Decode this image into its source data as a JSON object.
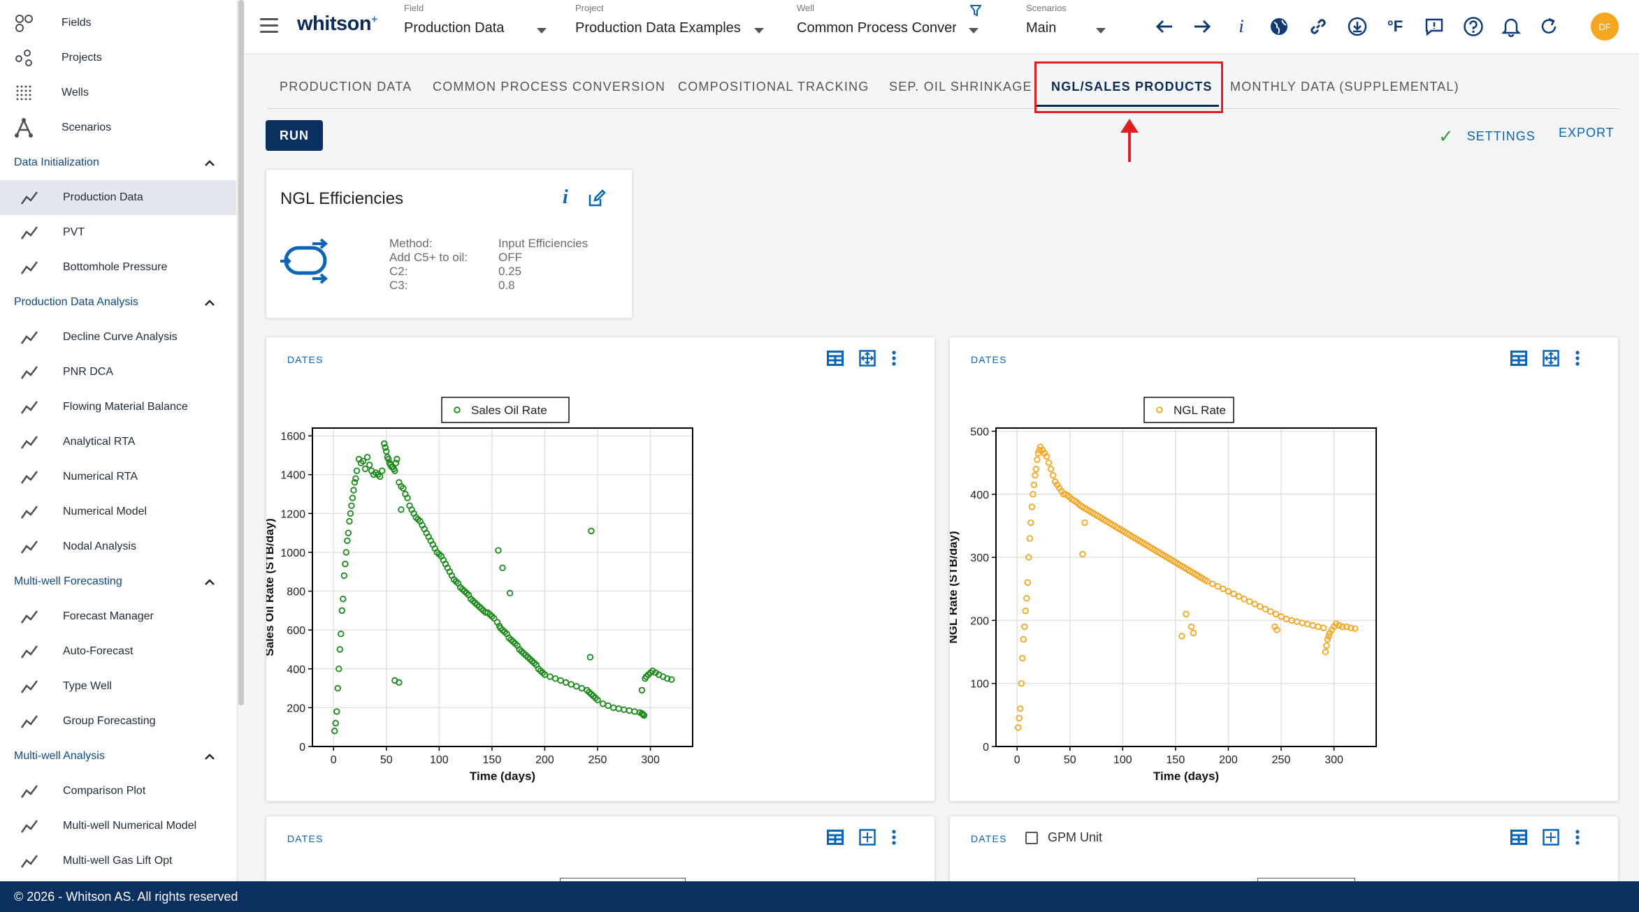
{
  "sidebar": {
    "top_items": [
      {
        "label": "Fields",
        "icon": "fields-icon"
      },
      {
        "label": "Projects",
        "icon": "projects-icon"
      },
      {
        "label": "Wells",
        "icon": "wells-icon"
      },
      {
        "label": "Scenarios",
        "icon": "scenarios-icon"
      }
    ],
    "sections": [
      {
        "label": "Data Initialization",
        "items": [
          "Production Data",
          "PVT",
          "Bottomhole Pressure"
        ]
      },
      {
        "label": "Production Data Analysis",
        "items": [
          "Decline Curve Analysis",
          "PNR DCA",
          "Flowing Material Balance",
          "Analytical RTA",
          "Numerical RTA",
          "Numerical Model",
          "Nodal Analysis"
        ]
      },
      {
        "label": "Multi-well Forecasting",
        "items": [
          "Forecast Manager",
          "Auto-Forecast",
          "Type Well",
          "Group Forecasting"
        ]
      },
      {
        "label": "Multi-well Analysis",
        "items": [
          "Comparison Plot",
          "Multi-well Numerical Model",
          "Multi-well Gas Lift Opt"
        ]
      }
    ],
    "active_item": "Production Data"
  },
  "header": {
    "logo": "whitson",
    "logo_sup": "+",
    "selectors": [
      {
        "caption": "Field",
        "value": "Production Data"
      },
      {
        "caption": "Project",
        "value": "Production Data Examples"
      },
      {
        "caption": "Well",
        "value": "Common Process Conversi"
      },
      {
        "caption": "Scenarios",
        "value": "Main"
      }
    ],
    "unit_label": "°F",
    "info_label": "i",
    "avatar_initials": "DF"
  },
  "tabs": [
    "PRODUCTION DATA",
    "COMMON PROCESS CONVERSION",
    "COMPOSITIONAL TRACKING",
    "SEP. OIL SHRINKAGE",
    "NGL/SALES PRODUCTS",
    "MONTHLY DATA (SUPPLEMENTAL)"
  ],
  "active_tab": "NGL/SALES PRODUCTS",
  "toolbar": {
    "run_label": "RUN",
    "settings_label": "SETTINGS",
    "export_label": "EXPORT"
  },
  "ngl_card": {
    "title": "NGL Efficiencies",
    "info": "i",
    "rows": [
      {
        "key": "Method:",
        "value": "Input Efficiencies"
      },
      {
        "key": "Add C5+ to oil:",
        "value": "OFF"
      },
      {
        "key": "C2:",
        "value": "0.25"
      },
      {
        "key": "C3:",
        "value": "0.8"
      }
    ]
  },
  "cards": {
    "dates_label": "DATES",
    "gpm_label": "GPM Unit"
  },
  "chart_data": [
    {
      "type": "scatter",
      "legend": "Sales Oil Rate",
      "xlabel": "Time (days)",
      "ylabel": "Sales Oil Rate (STB/day)",
      "xlim": [
        -20,
        340
      ],
      "ylim": [
        0,
        1640
      ],
      "xticks": [
        0,
        50,
        100,
        150,
        200,
        250,
        300
      ],
      "yticks": [
        0,
        200,
        400,
        600,
        800,
        1000,
        1200,
        1400,
        1600
      ],
      "color": "#1a8a1a",
      "legend_position": "top-center",
      "grid": true,
      "x": [
        1,
        2,
        3,
        4,
        5,
        6,
        7,
        8,
        9,
        10,
        11,
        12,
        13,
        14,
        15,
        16,
        17,
        18,
        19,
        20,
        21,
        22,
        24,
        26,
        28,
        30,
        32,
        34,
        36,
        38,
        40,
        42,
        44,
        46,
        48,
        49,
        50,
        51,
        52,
        53,
        54,
        55,
        56,
        57,
        58,
        59,
        60,
        62,
        64,
        66,
        68,
        70,
        72,
        74,
        76,
        78,
        80,
        82,
        84,
        86,
        88,
        90,
        92,
        94,
        96,
        98,
        100,
        102,
        104,
        106,
        108,
        110,
        112,
        114,
        116,
        118,
        120,
        122,
        124,
        126,
        128,
        130,
        132,
        134,
        136,
        138,
        140,
        142,
        144,
        146,
        148,
        150,
        152,
        155,
        157,
        158,
        160,
        162,
        164,
        166,
        168,
        170,
        172,
        174,
        176,
        178,
        180,
        182,
        184,
        186,
        188,
        190,
        192,
        194,
        196,
        198,
        200,
        205,
        210,
        215,
        220,
        225,
        230,
        235,
        240,
        242,
        244,
        246,
        248,
        250,
        255,
        260,
        265,
        270,
        275,
        280,
        285,
        290,
        292,
        293,
        294,
        295,
        296,
        298,
        300,
        302,
        305,
        308,
        312,
        316,
        320,
        58,
        62,
        64,
        156,
        160,
        167,
        244,
        243,
        292
      ],
      "y": [
        80,
        120,
        180,
        300,
        400,
        500,
        580,
        700,
        760,
        880,
        940,
        1000,
        1060,
        1100,
        1160,
        1200,
        1240,
        1280,
        1320,
        1360,
        1380,
        1420,
        1480,
        1460,
        1470,
        1430,
        1490,
        1450,
        1420,
        1400,
        1410,
        1400,
        1390,
        1420,
        1560,
        1540,
        1520,
        1490,
        1480,
        1460,
        1450,
        1440,
        1440,
        1430,
        1420,
        1460,
        1480,
        1360,
        1340,
        1330,
        1300,
        1280,
        1240,
        1220,
        1200,
        1180,
        1170,
        1160,
        1140,
        1120,
        1100,
        1080,
        1060,
        1040,
        1020,
        1000,
        990,
        980,
        960,
        940,
        920,
        900,
        880,
        860,
        850,
        840,
        820,
        810,
        800,
        790,
        780,
        760,
        750,
        740,
        730,
        720,
        710,
        700,
        690,
        690,
        680,
        670,
        660,
        640,
        620,
        610,
        600,
        590,
        580,
        560,
        550,
        540,
        530,
        520,
        500,
        490,
        480,
        470,
        460,
        450,
        440,
        430,
        420,
        400,
        390,
        380,
        370,
        360,
        350,
        340,
        330,
        320,
        310,
        300,
        290,
        280,
        270,
        260,
        250,
        240,
        220,
        210,
        200,
        195,
        190,
        185,
        180,
        175,
        170,
        165,
        160,
        350,
        360,
        370,
        380,
        390,
        380,
        370,
        360,
        350,
        345,
        340,
        330,
        1220,
        1010,
        920,
        790,
        1110,
        460,
        290,
        280,
        200
      ],
      "note_y_units": "Sales Oil Rate (STB/day)"
    },
    {
      "type": "scatter",
      "legend": "NGL Rate",
      "xlabel": "Time (days)",
      "ylabel": "NGL Rate (STB/day)",
      "xlim": [
        -20,
        340
      ],
      "ylim": [
        0,
        505
      ],
      "xticks": [
        0,
        50,
        100,
        150,
        200,
        250,
        300
      ],
      "yticks": [
        0,
        100,
        200,
        300,
        400,
        500
      ],
      "color": "#f5a623",
      "legend_position": "top-center",
      "grid": true,
      "x": [
        1,
        2,
        3,
        4,
        5,
        6,
        7,
        8,
        9,
        10,
        11,
        12,
        13,
        14,
        15,
        16,
        17,
        18,
        19,
        20,
        21,
        22,
        24,
        26,
        28,
        30,
        32,
        34,
        36,
        38,
        40,
        42,
        44,
        46,
        48,
        50,
        52,
        54,
        56,
        58,
        60,
        62,
        64,
        66,
        68,
        70,
        72,
        74,
        76,
        78,
        80,
        82,
        84,
        86,
        88,
        90,
        92,
        94,
        96,
        98,
        100,
        102,
        104,
        106,
        108,
        110,
        112,
        114,
        116,
        118,
        120,
        122,
        124,
        126,
        128,
        130,
        132,
        134,
        136,
        138,
        140,
        142,
        144,
        146,
        148,
        150,
        152,
        154,
        156,
        158,
        160,
        162,
        164,
        166,
        168,
        170,
        172,
        174,
        176,
        178,
        180,
        185,
        190,
        195,
        200,
        205,
        210,
        215,
        220,
        225,
        230,
        235,
        240,
        245,
        250,
        255,
        260,
        265,
        270,
        275,
        280,
        285,
        290,
        292,
        293,
        294,
        295,
        296,
        298,
        300,
        302,
        305,
        308,
        312,
        316,
        320,
        62,
        64,
        156,
        160,
        165,
        167,
        244,
        246
      ],
      "y": [
        30,
        45,
        60,
        100,
        140,
        170,
        190,
        215,
        235,
        260,
        300,
        330,
        355,
        380,
        400,
        415,
        430,
        440,
        455,
        465,
        470,
        475,
        470,
        465,
        460,
        450,
        440,
        430,
        420,
        415,
        410,
        405,
        400,
        400,
        398,
        395,
        392,
        390,
        388,
        385,
        382,
        380,
        378,
        376,
        374,
        372,
        370,
        368,
        366,
        364,
        362,
        360,
        358,
        356,
        354,
        352,
        350,
        348,
        346,
        344,
        342,
        340,
        338,
        336,
        334,
        332,
        330,
        328,
        326,
        324,
        322,
        320,
        318,
        316,
        314,
        312,
        310,
        308,
        306,
        304,
        302,
        300,
        298,
        296,
        294,
        292,
        290,
        288,
        286,
        284,
        282,
        280,
        278,
        276,
        274,
        272,
        270,
        268,
        266,
        264,
        262,
        258,
        254,
        250,
        246,
        242,
        238,
        234,
        230,
        226,
        222,
        218,
        214,
        210,
        206,
        202,
        200,
        198,
        196,
        194,
        192,
        190,
        188,
        150,
        160,
        170,
        175,
        180,
        185,
        190,
        195,
        192,
        190,
        190,
        188,
        187,
        305,
        355,
        175,
        210,
        190,
        180,
        190,
        185
      ]
    }
  ]
}
